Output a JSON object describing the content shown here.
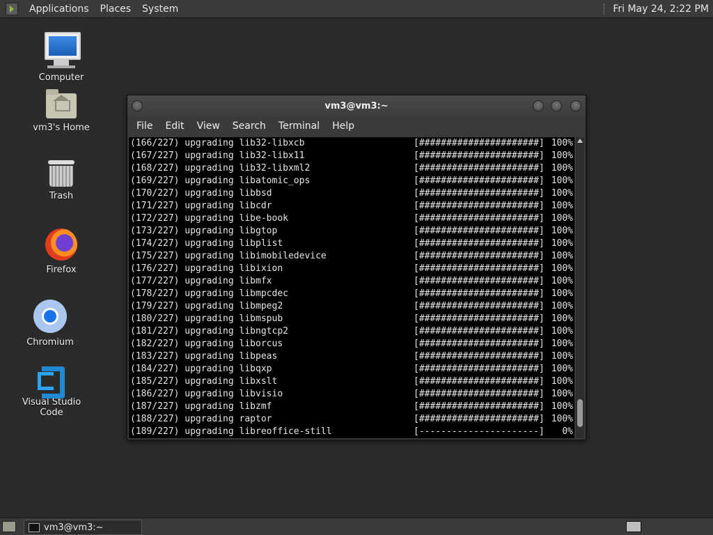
{
  "top_panel": {
    "menus": [
      "Applications",
      "Places",
      "System"
    ],
    "clock": "Fri May 24,  2:22 PM"
  },
  "desktop_icons": [
    {
      "label": "Computer",
      "icon": "computer-icon"
    },
    {
      "label": "vm3's Home",
      "icon": "home-folder-icon"
    },
    {
      "label": "Trash",
      "icon": "trash-icon"
    },
    {
      "label": "Firefox",
      "icon": "firefox-icon"
    },
    {
      "label": "Chromium",
      "icon": "chromium-icon"
    },
    {
      "label": "Visual Studio Code",
      "icon": "vscode-icon"
    }
  ],
  "terminal": {
    "title": "vm3@vm3:~",
    "menu": [
      "File",
      "Edit",
      "View",
      "Search",
      "Terminal",
      "Help"
    ],
    "lines": [
      {
        "left": "(166/227) upgrading lib32-libxcb",
        "bar": "[######################]",
        "pct": "100%"
      },
      {
        "left": "(167/227) upgrading lib32-libx11",
        "bar": "[######################]",
        "pct": "100%"
      },
      {
        "left": "(168/227) upgrading lib32-libxml2",
        "bar": "[######################]",
        "pct": "100%"
      },
      {
        "left": "(169/227) upgrading libatomic_ops",
        "bar": "[######################]",
        "pct": "100%"
      },
      {
        "left": "(170/227) upgrading libbsd",
        "bar": "[######################]",
        "pct": "100%"
      },
      {
        "left": "(171/227) upgrading libcdr",
        "bar": "[######################]",
        "pct": "100%"
      },
      {
        "left": "(172/227) upgrading libe-book",
        "bar": "[######################]",
        "pct": "100%"
      },
      {
        "left": "(173/227) upgrading libgtop",
        "bar": "[######################]",
        "pct": "100%"
      },
      {
        "left": "(174/227) upgrading libplist",
        "bar": "[######################]",
        "pct": "100%"
      },
      {
        "left": "(175/227) upgrading libimobiledevice",
        "bar": "[######################]",
        "pct": "100%"
      },
      {
        "left": "(176/227) upgrading libixion",
        "bar": "[######################]",
        "pct": "100%"
      },
      {
        "left": "(177/227) upgrading libmfx",
        "bar": "[######################]",
        "pct": "100%"
      },
      {
        "left": "(178/227) upgrading libmpcdec",
        "bar": "[######################]",
        "pct": "100%"
      },
      {
        "left": "(179/227) upgrading libmpeg2",
        "bar": "[######################]",
        "pct": "100%"
      },
      {
        "left": "(180/227) upgrading libmspub",
        "bar": "[######################]",
        "pct": "100%"
      },
      {
        "left": "(181/227) upgrading libngtcp2",
        "bar": "[######################]",
        "pct": "100%"
      },
      {
        "left": "(182/227) upgrading liborcus",
        "bar": "[######################]",
        "pct": "100%"
      },
      {
        "left": "(183/227) upgrading libpeas",
        "bar": "[######################]",
        "pct": "100%"
      },
      {
        "left": "(184/227) upgrading libqxp",
        "bar": "[######################]",
        "pct": "100%"
      },
      {
        "left": "(185/227) upgrading libxslt",
        "bar": "[######################]",
        "pct": "100%"
      },
      {
        "left": "(186/227) upgrading libvisio",
        "bar": "[######################]",
        "pct": "100%"
      },
      {
        "left": "(187/227) upgrading libzmf",
        "bar": "[######################]",
        "pct": "100%"
      },
      {
        "left": "(188/227) upgrading raptor",
        "bar": "[######################]",
        "pct": "100%"
      },
      {
        "left": "(189/227) upgrading libreoffice-still",
        "bar": "[----------------------]",
        "pct": "0%"
      }
    ]
  },
  "taskbar": {
    "window_label": "vm3@vm3:~"
  }
}
